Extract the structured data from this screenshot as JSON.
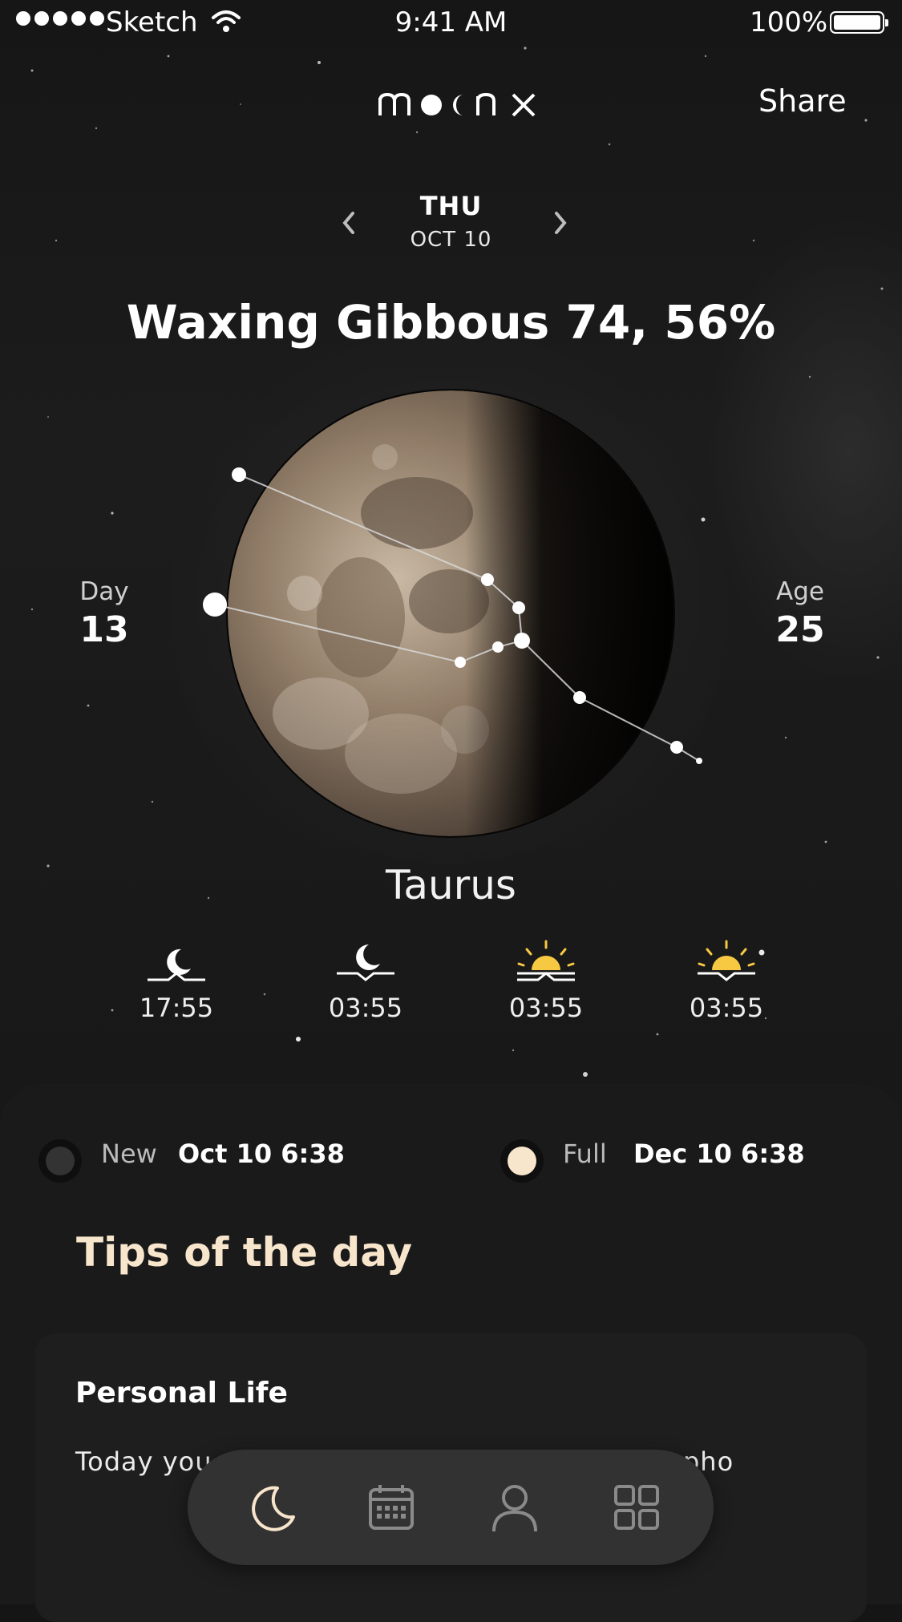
{
  "status_bar": {
    "carrier": "Sketch",
    "time": "9:41 AM",
    "battery": "100%"
  },
  "header": {
    "logo_text": "moonx",
    "share_label": "Share"
  },
  "date_nav": {
    "weekday": "THU",
    "date": "OCT 10"
  },
  "phase_title": "Waxing Gibbous 74, 56%",
  "moon": {
    "illumination_fraction": 0.56,
    "constellation": "Taurus"
  },
  "stats": {
    "day_label": "Day",
    "day_value": "13",
    "age_label": "Age",
    "age_value": "25"
  },
  "times": [
    {
      "icon": "moonrise-icon",
      "value": "17:55",
      "color": "#ffffff"
    },
    {
      "icon": "moonset-icon",
      "value": "03:55",
      "color": "#ffffff"
    },
    {
      "icon": "sunrise-icon",
      "value": "03:55",
      "color": "#f7c943"
    },
    {
      "icon": "sunset-icon",
      "value": "03:55",
      "color": "#f7c943"
    }
  ],
  "next_phases": {
    "new_label": "New",
    "new_date": "Oct 10 6:38",
    "full_label": "Full",
    "full_date": "Dec 10 6:38"
  },
  "tips": {
    "title": "Tips of the day",
    "card_title": "Personal Life",
    "card_text": "Today you adventure, quarrel ted, the atmospho"
  },
  "tabbar": {
    "items": [
      "moon-icon",
      "calendar-icon",
      "profile-icon",
      "grid-icon"
    ],
    "active_color": "#f7e5cc",
    "inactive_color": "#8a8a8a"
  }
}
